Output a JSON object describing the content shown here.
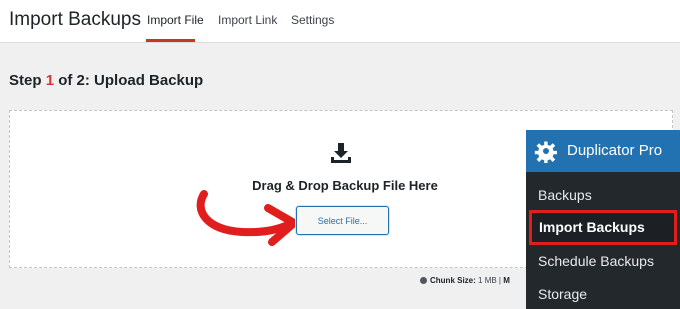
{
  "header": {
    "title": "Import Backups",
    "tabs": [
      {
        "label": "Import File",
        "active": true
      },
      {
        "label": "Import Link",
        "active": false
      },
      {
        "label": "Settings",
        "active": false
      }
    ]
  },
  "step": {
    "prefix": "Step",
    "current": "1",
    "suffix": "of 2: Upload Backup"
  },
  "dropzone": {
    "icon": "download-icon",
    "label": "Drag & Drop Backup File Here",
    "button_label": "Select File..."
  },
  "footer": {
    "chunk_label": "Chunk Size:",
    "chunk_value": "1 MB",
    "separator": "|",
    "truncated": "M"
  },
  "sidebar": {
    "title": "Duplicator Pro",
    "items": [
      {
        "label": "Backups"
      },
      {
        "label": "Import Backups",
        "active": true
      },
      {
        "label": "Schedule Backups"
      },
      {
        "label": "Storage"
      }
    ]
  },
  "colors": {
    "accent": "#c7371f",
    "highlight": "#e01e1e",
    "brand": "#2271b1",
    "sidebar_bg": "#23282d"
  }
}
